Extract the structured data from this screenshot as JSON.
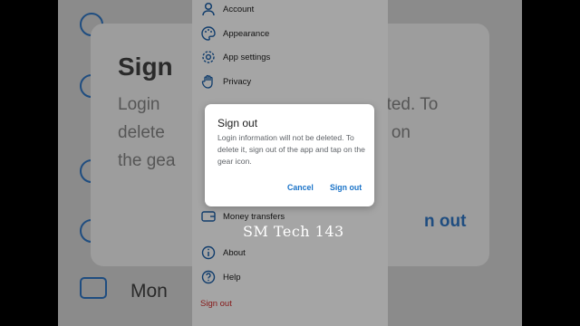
{
  "background": {
    "title": "Sign",
    "body_lines": [
      "Login",
      "delete",
      "the gea"
    ],
    "body_right": [
      "eted. To",
      "p on"
    ],
    "action": "n out",
    "last_item": "Mon"
  },
  "menu": {
    "items": [
      {
        "label": "Account",
        "icon": "person-icon"
      },
      {
        "label": "Appearance",
        "icon": "palette-icon"
      },
      {
        "label": "App settings",
        "icon": "gear-icon"
      },
      {
        "label": "Privacy",
        "icon": "hand-icon"
      },
      {
        "label": "Money transfers",
        "icon": "wallet-icon"
      },
      {
        "label": "About",
        "icon": "info-icon"
      },
      {
        "label": "Help",
        "icon": "help-icon"
      }
    ],
    "sign_out": "Sign out"
  },
  "dialog": {
    "title": "Sign out",
    "body": "Login information will not be deleted. To delete it, sign out of the app and tap on the gear icon.",
    "cancel_label": "Cancel",
    "confirm_label": "Sign out"
  },
  "watermark": "SM Tech 143",
  "colors": {
    "accent": "#1a73c8",
    "danger": "#c62828",
    "dim_overlay": "rgba(0,0,0,0.32)"
  }
}
